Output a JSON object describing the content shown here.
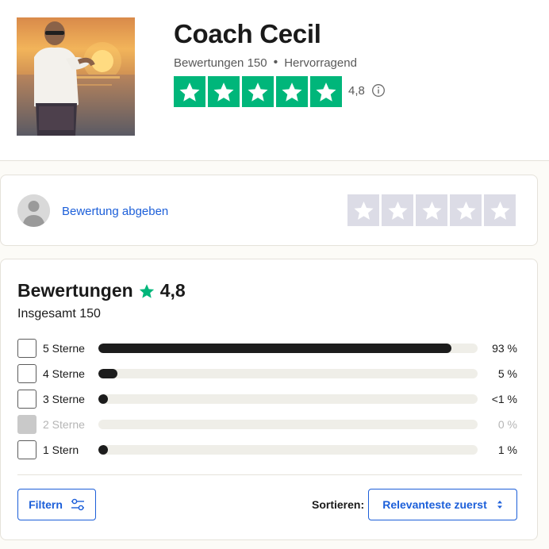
{
  "business": {
    "name": "Coach Cecil",
    "review_count_text": "Bewertungen 150",
    "rating_word": "Hervorragend",
    "score": "4,8",
    "star_color": "#00b67a"
  },
  "write_review": {
    "link_label": "Bewertung abgeben",
    "empty_star_color": "#dcdce6"
  },
  "reviews_summary": {
    "title": "Bewertungen",
    "score": "4,8",
    "total_text": "Insgesamt 150",
    "distribution": [
      {
        "label": "5 Sterne",
        "percent_text": "93 %",
        "percent": 93,
        "enabled": true
      },
      {
        "label": "4 Sterne",
        "percent_text": "5 %",
        "percent": 5,
        "enabled": true
      },
      {
        "label": "3 Sterne",
        "percent_text": "<1 %",
        "percent": 0.5,
        "enabled": true
      },
      {
        "label": "2 Sterne",
        "percent_text": "0 %",
        "percent": 0,
        "enabled": false
      },
      {
        "label": "1 Stern",
        "percent_text": "1 %",
        "percent": 1,
        "enabled": true
      }
    ]
  },
  "controls": {
    "filter_label": "Filtern",
    "sort_label": "Sortieren:",
    "sort_value": "Relevanteste zuerst"
  },
  "icons": {
    "info": "info-icon",
    "filter": "sliders-icon",
    "sort": "up-down-arrows-icon",
    "star": "star-icon",
    "avatar": "user-silhouette-icon"
  },
  "colors": {
    "link": "#1c5fd9",
    "bar_fill": "#1c1c1c",
    "bar_track": "#efeee8"
  }
}
